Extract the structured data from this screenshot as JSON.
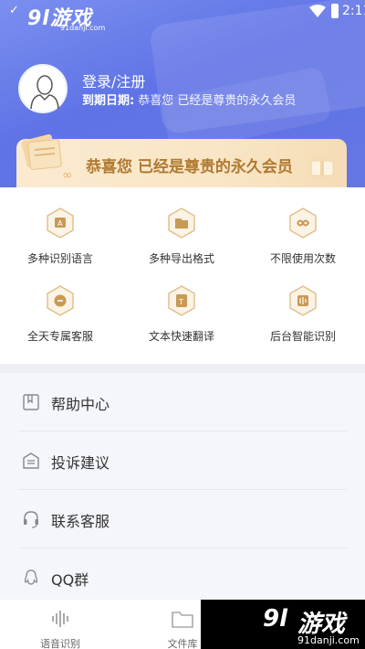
{
  "status_bar": {
    "time": "2:11"
  },
  "watermark": {
    "brand": "游戏",
    "number": "9l",
    "url_small": "91danji.com",
    "url_large": "91danji.com"
  },
  "profile": {
    "login_label": "登录/注册",
    "expire_label": "到期日期:",
    "expire_value": "恭喜您 已经是尊贵的永久会员"
  },
  "vip_banner": {
    "title": "恭喜您 已经是尊贵的永久会员"
  },
  "features": [
    {
      "label": "多种识别语言",
      "icon": "language-icon"
    },
    {
      "label": "多种导出格式",
      "icon": "folder-icon"
    },
    {
      "label": "不限使用次数",
      "icon": "infinity-icon"
    },
    {
      "label": "全天专属客服",
      "icon": "chat-icon"
    },
    {
      "label": "文本快速翻译",
      "icon": "translate-icon"
    },
    {
      "label": "后台智能识别",
      "icon": "voice-icon"
    }
  ],
  "menu": [
    {
      "label": "帮助中心",
      "icon": "help-icon"
    },
    {
      "label": "投诉建议",
      "icon": "feedback-icon"
    },
    {
      "label": "联系客服",
      "icon": "headset-icon"
    },
    {
      "label": "QQ群",
      "icon": "qq-icon"
    }
  ],
  "tabs": [
    {
      "label": "语音识别",
      "icon": "waveform-icon"
    },
    {
      "label": "文件库",
      "icon": "folder-icon"
    }
  ],
  "colors": {
    "header": "#6578e6",
    "gold": "#b07a32",
    "icon_gold": "#c99a55"
  }
}
